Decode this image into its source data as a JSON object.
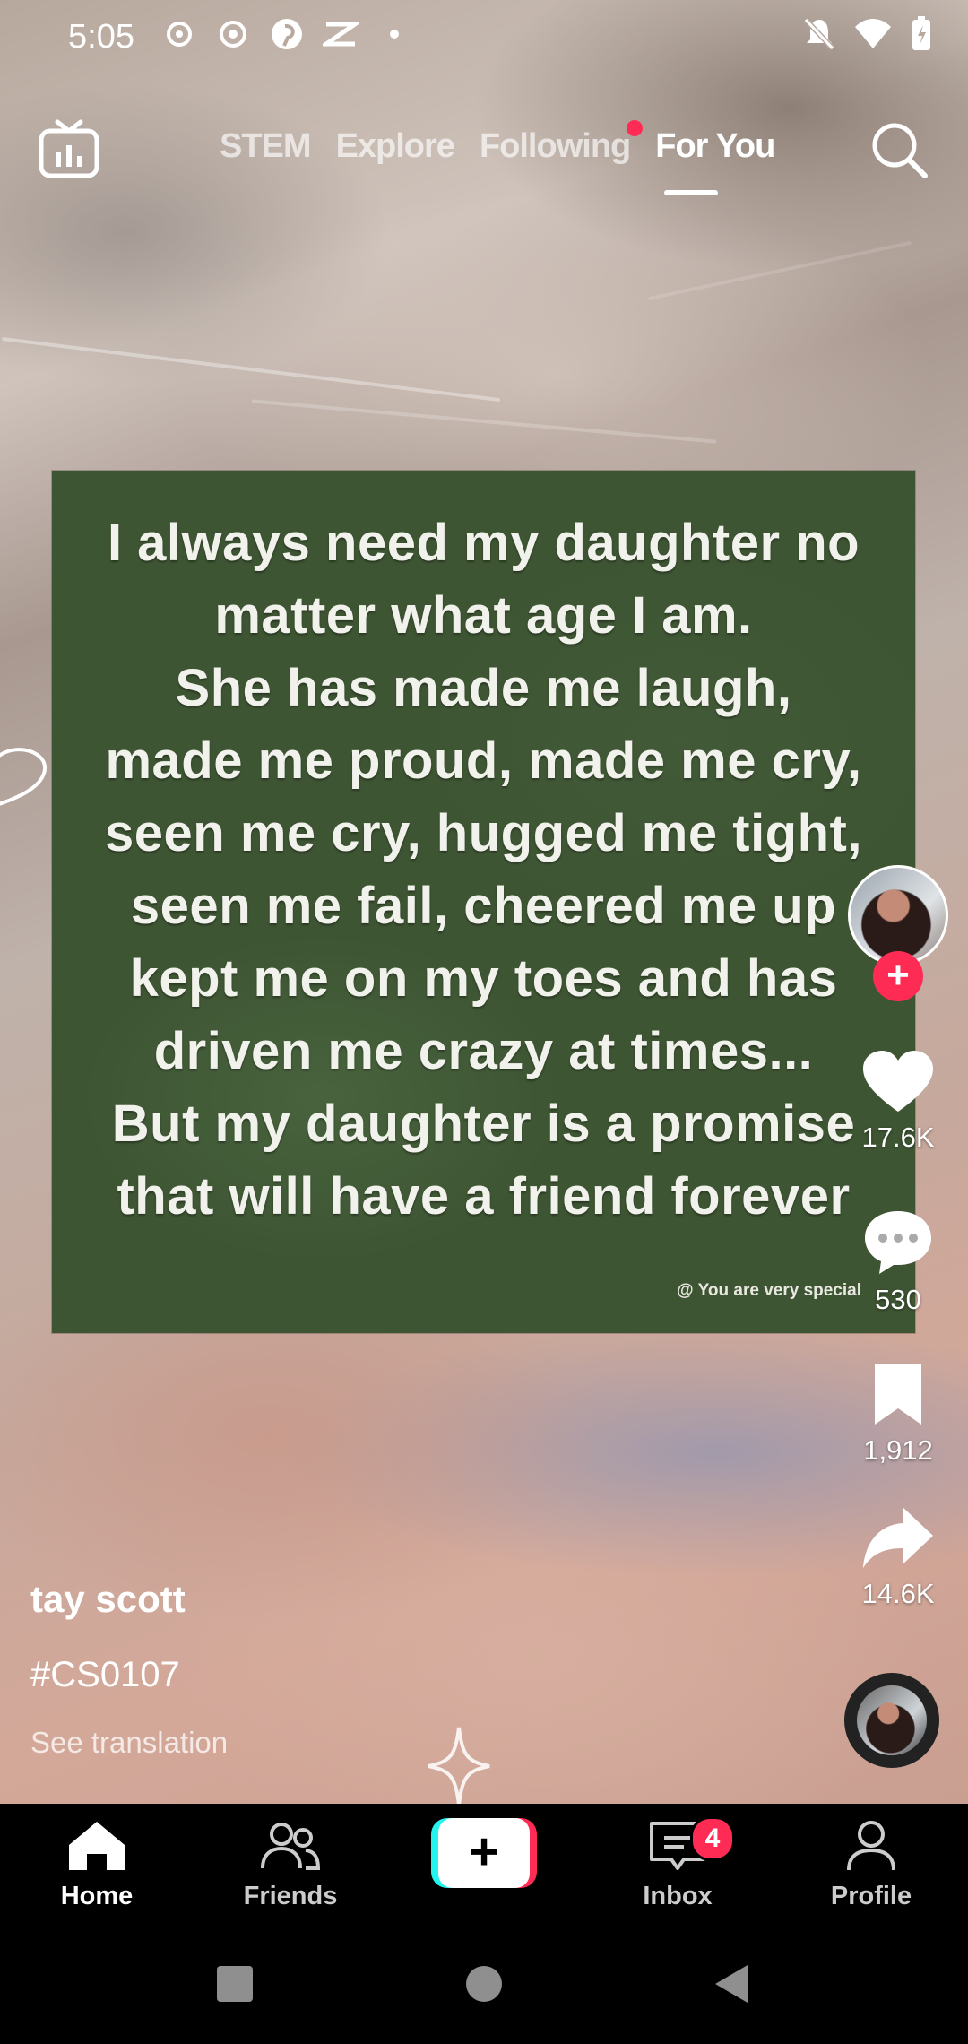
{
  "status_bar": {
    "time": "5:05"
  },
  "top_nav": {
    "tabs": [
      {
        "label": "STEM",
        "active": false
      },
      {
        "label": "Explore",
        "active": false
      },
      {
        "label": "Following",
        "active": false,
        "has_dot": true
      },
      {
        "label": "For You",
        "active": true
      }
    ]
  },
  "video": {
    "quote_lines": [
      "I always need my daughter no",
      "matter what age I am.",
      "She has made me laugh,",
      "made me proud, made me cry,",
      "seen me cry, hugged me tight,",
      "seen me fail, cheered me up",
      "kept me on my toes and has",
      "driven me crazy at times...",
      "But my daughter is a promise",
      "that will have a friend forever"
    ],
    "watermark": "@ You are very special"
  },
  "rail": {
    "likes": "17.6K",
    "comments": "530",
    "saves": "1,912",
    "shares": "14.6K"
  },
  "caption": {
    "author": "tay scott",
    "hashtag": "#CS0107",
    "see_translation": "See translation"
  },
  "bottom_nav": {
    "home": "Home",
    "friends": "Friends",
    "inbox": "Inbox",
    "inbox_badge": "4",
    "profile": "Profile"
  },
  "colors": {
    "accent": "#fe2c55",
    "cyan": "#25f4ee",
    "card": "#3e5533"
  }
}
